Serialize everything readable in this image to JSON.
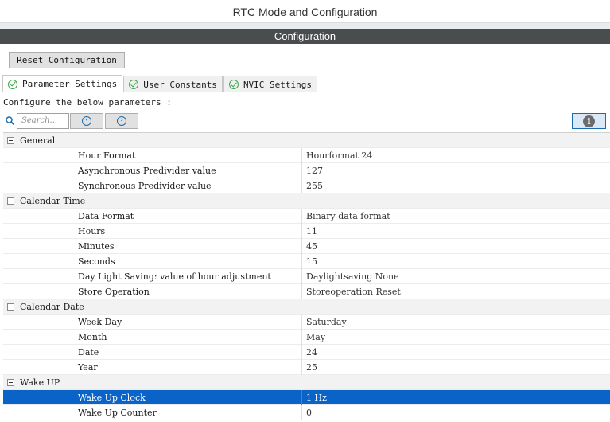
{
  "window": {
    "title": "RTC Mode and Configuration"
  },
  "section": {
    "title": "Configuration"
  },
  "toolbar": {
    "reset_label": "Reset Configuration"
  },
  "tabs": [
    {
      "label": "Parameter Settings",
      "active": true
    },
    {
      "label": "User Constants",
      "active": false
    },
    {
      "label": "NVIC Settings",
      "active": false
    }
  ],
  "configure_label": "Configure the below parameters :",
  "search": {
    "placeholder": "Search..."
  },
  "colors": {
    "selected_row": "#0a64c8",
    "header_bar": "#4a4d4e",
    "check_green": "#3aa54a",
    "accent_blue": "#1a6bb0"
  },
  "groups": [
    {
      "label": "General",
      "params": [
        {
          "name": "Hour Format",
          "value": "Hourformat 24"
        },
        {
          "name": "Asynchronous Predivider value",
          "value": "127"
        },
        {
          "name": "Synchronous Predivider value",
          "value": "255"
        }
      ]
    },
    {
      "label": "Calendar Time",
      "params": [
        {
          "name": "Data Format",
          "value": "Binary data format"
        },
        {
          "name": "Hours",
          "value": "11"
        },
        {
          "name": "Minutes",
          "value": "45"
        },
        {
          "name": "Seconds",
          "value": "15"
        },
        {
          "name": "Day Light Saving: value of hour adjustment",
          "value": "Daylightsaving None"
        },
        {
          "name": "Store Operation",
          "value": "Storeoperation Reset"
        }
      ]
    },
    {
      "label": "Calendar Date",
      "params": [
        {
          "name": "Week Day",
          "value": "Saturday"
        },
        {
          "name": "Month",
          "value": "May"
        },
        {
          "name": "Date",
          "value": "24"
        },
        {
          "name": "Year",
          "value": "25"
        }
      ]
    },
    {
      "label": "Wake UP",
      "params": [
        {
          "name": "Wake Up Clock",
          "value": "1 Hz",
          "selected": true
        },
        {
          "name": "Wake Up Counter",
          "value": "0"
        }
      ]
    }
  ]
}
